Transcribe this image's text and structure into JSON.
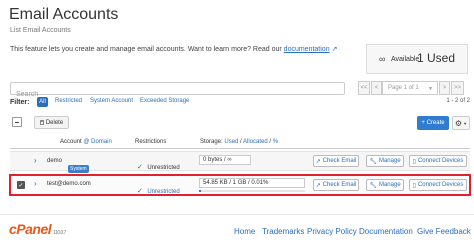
{
  "page": {
    "title": "Email Accounts",
    "subtitle": "List Email Accounts",
    "intro_text": "This feature lets you create and manage email accounts. Want to learn more? Read our",
    "intro_link": "documentation"
  },
  "stats": {
    "label": "Available",
    "value": "1 Used"
  },
  "search": {
    "placeholder": "Search"
  },
  "pagination": {
    "first": "<<",
    "prev": "<",
    "page_select": "Page 1 of 1",
    "next": ">",
    "last": ">>",
    "count_text": "1 - 2 of 2"
  },
  "filter": {
    "label": "Filter:",
    "options": [
      "All",
      "Restricted",
      "System Account",
      "Exceeded Storage"
    ]
  },
  "toolbar": {
    "delete_label": "Delete",
    "create_label": "+ Create"
  },
  "table": {
    "headers": {
      "account": "Account",
      "at_domain": "@ Domain",
      "restrictions": "Restrictions",
      "storage": "Storage:",
      "storage_used": "Used",
      "storage_allocated": "Allocated",
      "storage_percent": "%"
    },
    "rows": [
      {
        "account": "demo",
        "badge": "System",
        "restrictions": "Unrestricted",
        "storage": "0 bytes / ∞",
        "usage_fraction": 0,
        "actions": [
          "Check Email",
          "Manage",
          "Connect Devices"
        ]
      },
      {
        "account": "test@demo.com",
        "restrictions": "Unrestricted",
        "storage": "54.85 KB / 1 GB / 0.01%",
        "usage_fraction": 0.0001,
        "selected": true,
        "actions": [
          "Check Email",
          "Manage",
          "Connect Devices"
        ]
      }
    ]
  },
  "footer": {
    "brand": "cPanel",
    "version": "110.0.7",
    "links": [
      "Home",
      "Trademarks",
      "Privacy Policy",
      "Documentation",
      "Give Feedback"
    ]
  },
  "colors": {
    "accent": "#2f7cd0",
    "highlight_border": "#e0222f",
    "brand": "#e8591a"
  }
}
